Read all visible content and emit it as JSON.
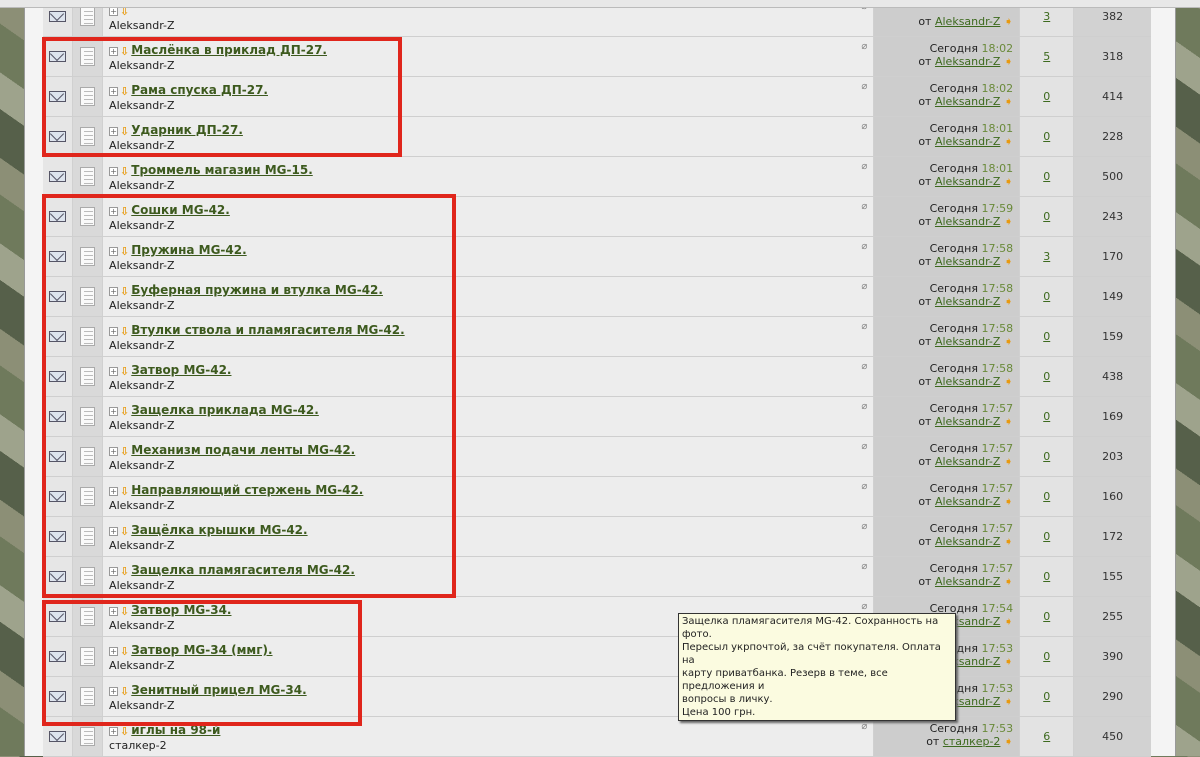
{
  "topics": [
    {
      "title": "",
      "author": "Aleksandr-Z",
      "date": "",
      "time": "",
      "last_by": "Aleksandr-Z",
      "replies": "3",
      "views": "382"
    },
    {
      "title": "Маслёнка в приклад ДП-27.",
      "author": "Aleksandr-Z",
      "date": "Сегодня",
      "time": "18:02",
      "last_by": "Aleksandr-Z",
      "replies": "5",
      "views": "318"
    },
    {
      "title": "Рама спуска ДП-27.",
      "author": "Aleksandr-Z",
      "date": "Сегодня",
      "time": "18:02",
      "last_by": "Aleksandr-Z",
      "replies": "0",
      "views": "414"
    },
    {
      "title": "Ударник ДП-27.",
      "author": "Aleksandr-Z",
      "date": "Сегодня",
      "time": "18:01",
      "last_by": "Aleksandr-Z",
      "replies": "0",
      "views": "228"
    },
    {
      "title": "Троммель магазин MG-15.",
      "author": "Aleksandr-Z",
      "date": "Сегодня",
      "time": "18:01",
      "last_by": "Aleksandr-Z",
      "replies": "0",
      "views": "500"
    },
    {
      "title": "Сошки MG-42.",
      "author": "Aleksandr-Z",
      "date": "Сегодня",
      "time": "17:59",
      "last_by": "Aleksandr-Z",
      "replies": "0",
      "views": "243"
    },
    {
      "title": "Пружина MG-42.",
      "author": "Aleksandr-Z",
      "date": "Сегодня",
      "time": "17:58",
      "last_by": "Aleksandr-Z",
      "replies": "3",
      "views": "170"
    },
    {
      "title": "Буферная пружина и втулка MG-42.",
      "author": "Aleksandr-Z",
      "date": "Сегодня",
      "time": "17:58",
      "last_by": "Aleksandr-Z",
      "replies": "0",
      "views": "149"
    },
    {
      "title": "Втулки ствола и пламягасителя MG-42.",
      "author": "Aleksandr-Z",
      "date": "Сегодня",
      "time": "17:58",
      "last_by": "Aleksandr-Z",
      "replies": "0",
      "views": "159"
    },
    {
      "title": "Затвор MG-42.",
      "author": "Aleksandr-Z",
      "date": "Сегодня",
      "time": "17:58",
      "last_by": "Aleksandr-Z",
      "replies": "0",
      "views": "438"
    },
    {
      "title": "Защелка приклада MG-42.",
      "author": "Aleksandr-Z",
      "date": "Сегодня",
      "time": "17:57",
      "last_by": "Aleksandr-Z",
      "replies": "0",
      "views": "169"
    },
    {
      "title": "Механизм подачи ленты MG-42.",
      "author": "Aleksandr-Z",
      "date": "Сегодня",
      "time": "17:57",
      "last_by": "Aleksandr-Z",
      "replies": "0",
      "views": "203"
    },
    {
      "title": "Направляющий стержень MG-42.",
      "author": "Aleksandr-Z",
      "date": "Сегодня",
      "time": "17:57",
      "last_by": "Aleksandr-Z",
      "replies": "0",
      "views": "160"
    },
    {
      "title": "Защёлка крышки MG-42.",
      "author": "Aleksandr-Z",
      "date": "Сегодня",
      "time": "17:57",
      "last_by": "Aleksandr-Z",
      "replies": "0",
      "views": "172"
    },
    {
      "title": "Защелка пламягасителя MG-42.",
      "author": "Aleksandr-Z",
      "date": "Сегодня",
      "time": "17:57",
      "last_by": "Aleksandr-Z",
      "replies": "0",
      "views": "155"
    },
    {
      "title": "Затвор MG-34.",
      "author": "Aleksandr-Z",
      "date": "Сегодня",
      "time": "17:54",
      "last_by": "Aleksandr-Z",
      "replies": "0",
      "views": "255"
    },
    {
      "title": "Затвор MG-34 (ммг).",
      "author": "Aleksandr-Z",
      "date": "Сегодня",
      "time": "17:53",
      "last_by": "Aleksandr-Z",
      "replies": "0",
      "views": "390"
    },
    {
      "title": "Зенитный прицел MG-34.",
      "author": "Aleksandr-Z",
      "date": "Сегодня",
      "time": "17:53",
      "last_by": "Aleksandr-Z",
      "replies": "0",
      "views": "290"
    },
    {
      "title": "иглы на 98-й",
      "author": "сталкер-2",
      "date": "Сегодня",
      "time": "17:53",
      "last_by": "сталкер-2",
      "replies": "6",
      "views": "450"
    }
  ],
  "from_label": "от",
  "tooltip": [
    "Защелка пламягасителя MG-42. Сохранность на фото.",
    "Пересыл укрпочтой, за счёт покупателя. Оплата на",
    "карту приватбанка. Резерв в теме, все предложения и",
    "вопросы в личку.",
    "Цена 100 грн."
  ]
}
